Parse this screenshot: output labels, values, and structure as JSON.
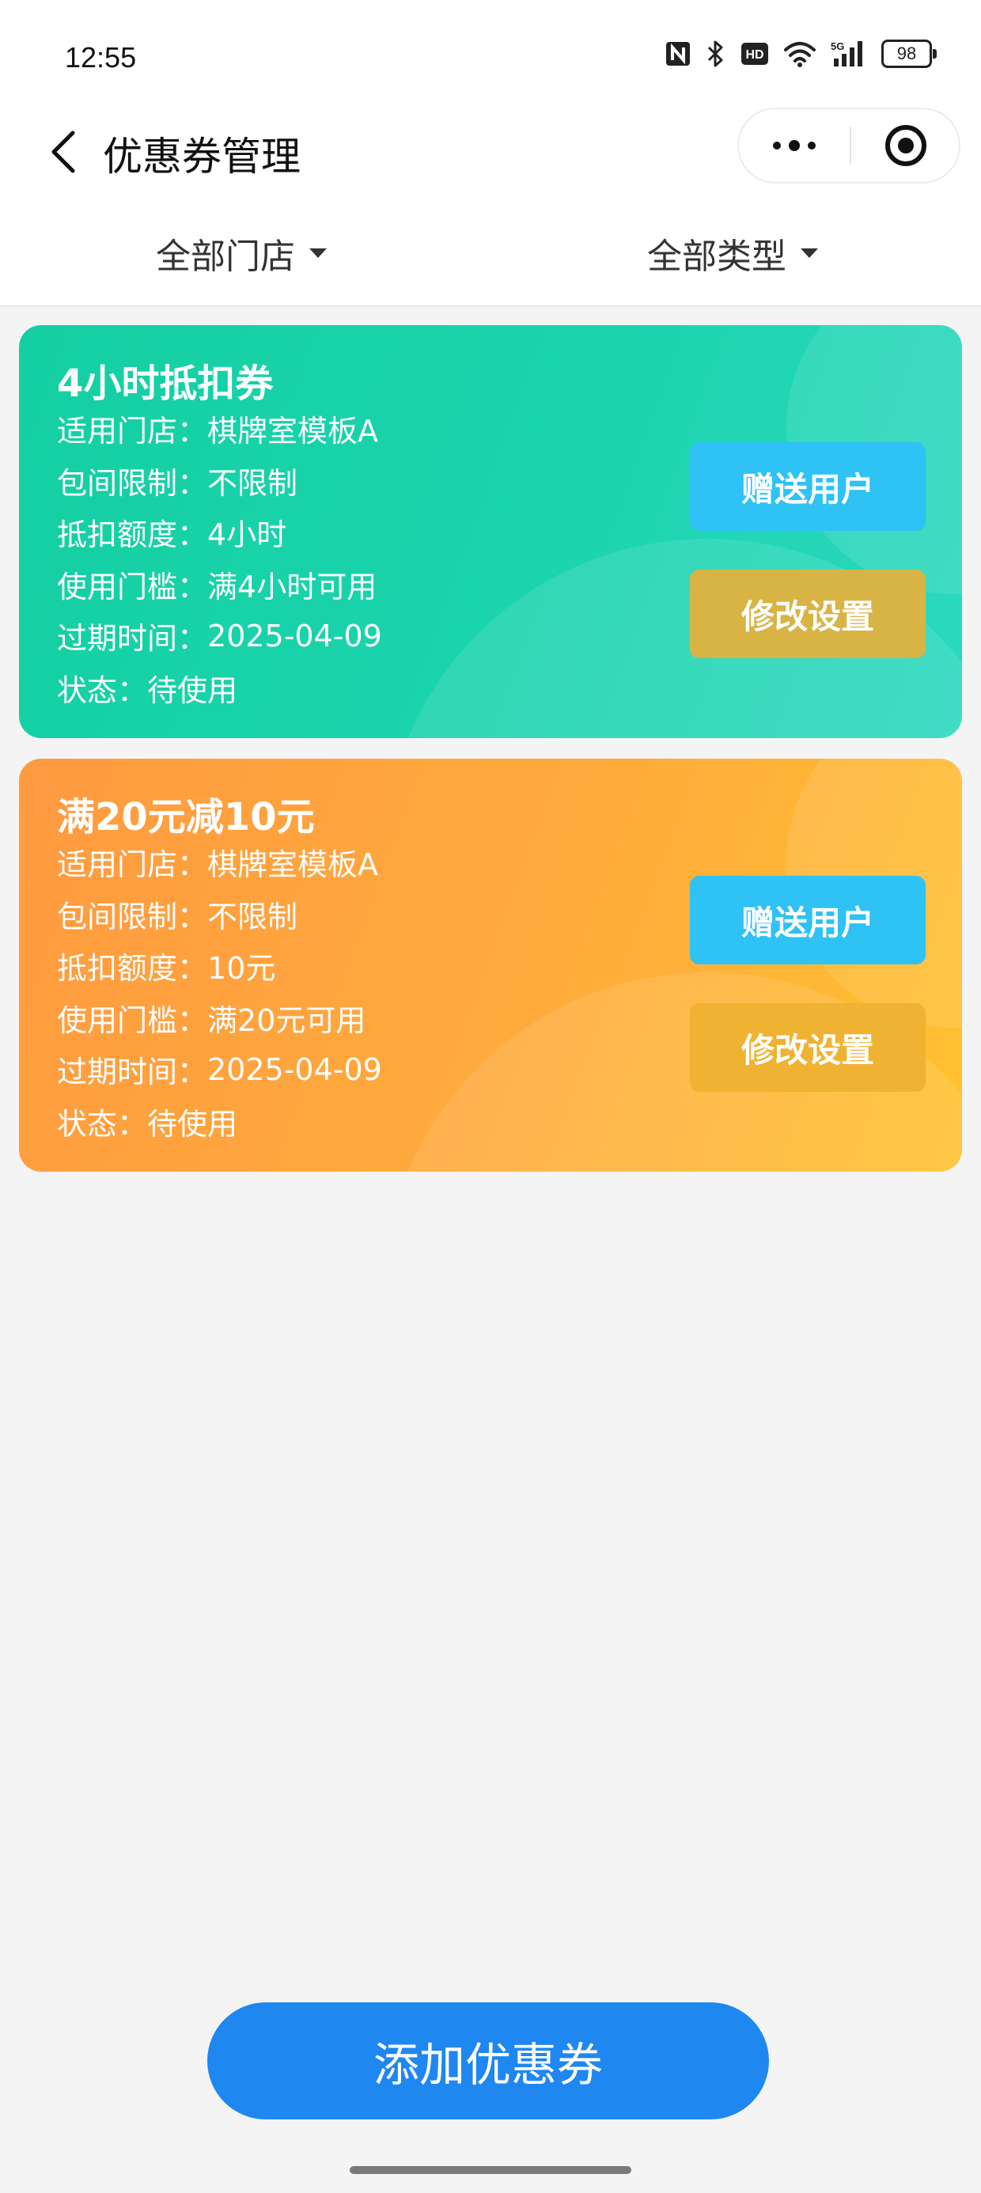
{
  "status_bar": {
    "time": "12:55",
    "battery": "98",
    "network": "5G",
    "icons": [
      "nfc-icon",
      "bluetooth-icon",
      "hd-icon",
      "wifi-icon",
      "signal-icon",
      "battery-icon"
    ]
  },
  "nav": {
    "title": "优惠券管理",
    "back_icon": "chevron-left-icon",
    "more_icon": "more-dots-icon",
    "close_icon": "target-circle-icon"
  },
  "filters": {
    "store": "全部门店",
    "type": "全部类型"
  },
  "coupons": [
    {
      "name": "4小时抵扣券",
      "color_start": "#14cfa2",
      "color_end": "#2cd8c0",
      "rows": [
        {
          "label": "适用门店：",
          "value": "棋牌室模板A"
        },
        {
          "label": "包间限制：",
          "value": "不限制"
        },
        {
          "label": "抵扣额度：",
          "value": "4小时"
        },
        {
          "label": "使用门槛：",
          "value": "满4小时可用"
        },
        {
          "label": "过期时间：",
          "value": "2025-04-09"
        },
        {
          "label": "状态：",
          "value": "待使用"
        }
      ],
      "gift_label": "赠送用户",
      "edit_label": "修改设置"
    },
    {
      "name": "满20元减10元",
      "color_start": "#ff9a40",
      "color_end": "#ffc230",
      "rows": [
        {
          "label": "适用门店：",
          "value": "棋牌室模板A"
        },
        {
          "label": "包间限制：",
          "value": "不限制"
        },
        {
          "label": "抵扣额度：",
          "value": "10元"
        },
        {
          "label": "使用门槛：",
          "value": "满20元可用"
        },
        {
          "label": "过期时间：",
          "value": "2025-04-09"
        },
        {
          "label": "状态：",
          "value": "待使用"
        }
      ],
      "gift_label": "赠送用户",
      "edit_label": "修改设置"
    }
  ],
  "add_button": "添加优惠券",
  "colors": {
    "accent_blue": "#1e87f0",
    "gift_button": "#2ec2f5",
    "edit_button_green_card": "#d8b445",
    "edit_button_orange_card": "#f0b232"
  }
}
